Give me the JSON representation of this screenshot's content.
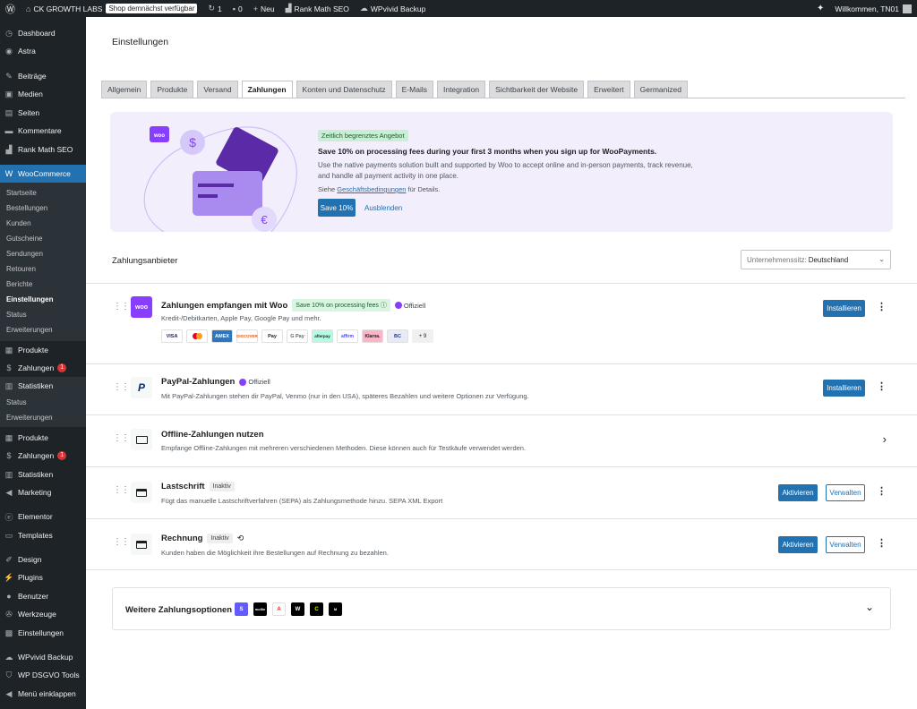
{
  "admin_bar": {
    "site_name": "CK GROWTH LABS",
    "shop_badge": "Shop demnächst verfügbar",
    "updates_count": "1",
    "comments_count": "0",
    "new_label": "Neu",
    "rank_math": "Rank Math SEO",
    "wpvivid": "WPvivid Backup",
    "welcome": "Willkommen, TN01"
  },
  "sidebar": {
    "items": [
      {
        "label": "Dashboard",
        "icon": "dashboard-icon"
      },
      {
        "label": "Astra",
        "icon": "astra-icon"
      },
      {
        "label": "Beiträge",
        "icon": "pin-icon"
      },
      {
        "label": "Medien",
        "icon": "media-icon"
      },
      {
        "label": "Seiten",
        "icon": "page-icon"
      },
      {
        "label": "Kommentare",
        "icon": "comment-icon"
      },
      {
        "label": "Rank Math SEO",
        "icon": "rankmath-icon"
      },
      {
        "label": "WooCommerce",
        "icon": "woo-icon"
      }
    ],
    "woo_sub": [
      "Startseite",
      "Bestellungen",
      "Kunden",
      "Gutscheine",
      "Sendungen",
      "Retouren",
      "Berichte",
      "Einstellungen",
      "Status",
      "Erweiterungen"
    ],
    "mid_items": [
      {
        "label": "Produkte",
        "icon": "box-icon"
      },
      {
        "label": "Zahlungen",
        "icon": "dollar-icon",
        "badge": "1"
      },
      {
        "label": "Statistiken",
        "icon": "chart-icon"
      }
    ],
    "stats_sub": [
      "Status",
      "Erweiterungen"
    ],
    "lower_items": [
      {
        "label": "Produkte",
        "icon": "box-icon"
      },
      {
        "label": "Zahlungen",
        "icon": "dollar-icon",
        "badge": "1"
      },
      {
        "label": "Statistiken",
        "icon": "chart-icon"
      },
      {
        "label": "Marketing",
        "icon": "megaphone-icon"
      },
      {
        "label": "Elementor",
        "icon": "elementor-icon"
      },
      {
        "label": "Templates",
        "icon": "folder-icon"
      },
      {
        "label": "Design",
        "icon": "brush-icon"
      },
      {
        "label": "Plugins",
        "icon": "plugin-icon"
      },
      {
        "label": "Benutzer",
        "icon": "user-icon"
      },
      {
        "label": "Werkzeuge",
        "icon": "wrench-icon"
      },
      {
        "label": "Einstellungen",
        "icon": "settings-icon"
      },
      {
        "label": "WPvivid Backup",
        "icon": "cloud-icon"
      },
      {
        "label": "WP DSGVO Tools",
        "icon": "shield-icon"
      },
      {
        "label": "Menü einklappen",
        "icon": "collapse-icon"
      }
    ]
  },
  "page": {
    "title": "Einstellungen",
    "tabs": [
      "Allgemein",
      "Produkte",
      "Versand",
      "Zahlungen",
      "Konten und Datenschutz",
      "E-Mails",
      "Integration",
      "Sichtbarkeit der Website",
      "Erweitert",
      "Germanized"
    ],
    "active_tab": "Zahlungen"
  },
  "promo": {
    "pill": "Zeitlich begrenztes Angebot",
    "title": "Save 10% on processing fees during your first 3 months when you sign up for WooPayments.",
    "desc": "Use the native payments solution built and supported by Woo to accept online and in-person payments, track revenue, and handle all payment activity in one place.",
    "terms_prefix": "Siehe ",
    "terms_link": "Geschäftsbedingungen",
    "terms_suffix": " für Details.",
    "save_button": "Save 10%",
    "hide_button": "Ausblenden",
    "woo_badge": "woo"
  },
  "providers_section": {
    "title": "Zahlungsanbieter",
    "country_label": "Unternehmenssitz:",
    "country_value": "Deutschland"
  },
  "providers": [
    {
      "name": "Zahlungen empfangen mit Woo",
      "tag": "Save 10% on processing fees",
      "official": "Offiziell",
      "desc": "Kredit-/Debitkarten, Apple Pay, Google Pay und mehr.",
      "button": "Installieren",
      "icon_text": "woo",
      "logos": [
        "VISA",
        "MC",
        "AMEX",
        "DISCOVER",
        "Pay",
        "G Pay",
        "afterpay",
        "affirm",
        "Klarna.",
        "BC",
        "+ 9"
      ]
    },
    {
      "name": "PayPal-Zahlungen",
      "official": "Offiziell",
      "desc": "Mit PayPal-Zahlungen stehen dir PayPal, Venmo (nur in den USA), späteres Bezahlen und weitere Optionen zur Verfügung.",
      "button": "Installieren",
      "icon_text": "P"
    },
    {
      "name": "Offline-Zahlungen nutzen",
      "desc": "Empfange Offline-Zahlungen mit mehreren verschiedenen Methoden. Diese können auch für Testkäufe verwendet werden."
    },
    {
      "name": "Lastschrift",
      "tag": "Inaktiv",
      "desc": "Fügt das manuelle Lastschriftverfahren (SEPA) als Zahlungsmethode hinzu. SEPA XML Export",
      "primary": "Aktivieren",
      "secondary": "Verwalten"
    },
    {
      "name": "Rechnung",
      "tag": "Inaktiv",
      "desc": "Kunden haben die Möglichkeit ihre Bestellungen auf Rechnung zu bezahlen.",
      "primary": "Aktivieren",
      "secondary": "Verwalten"
    }
  ],
  "more_options": {
    "title": "Weitere Zahlungsoptionen",
    "logos": [
      "S",
      "mollie",
      "A",
      "W",
      "C",
      "M"
    ]
  },
  "colors": {
    "wp_blue": "#2271b1",
    "admin_dark": "#1d2327",
    "woo_purple": "#873eff",
    "promo_bg": "#f2eefc"
  }
}
